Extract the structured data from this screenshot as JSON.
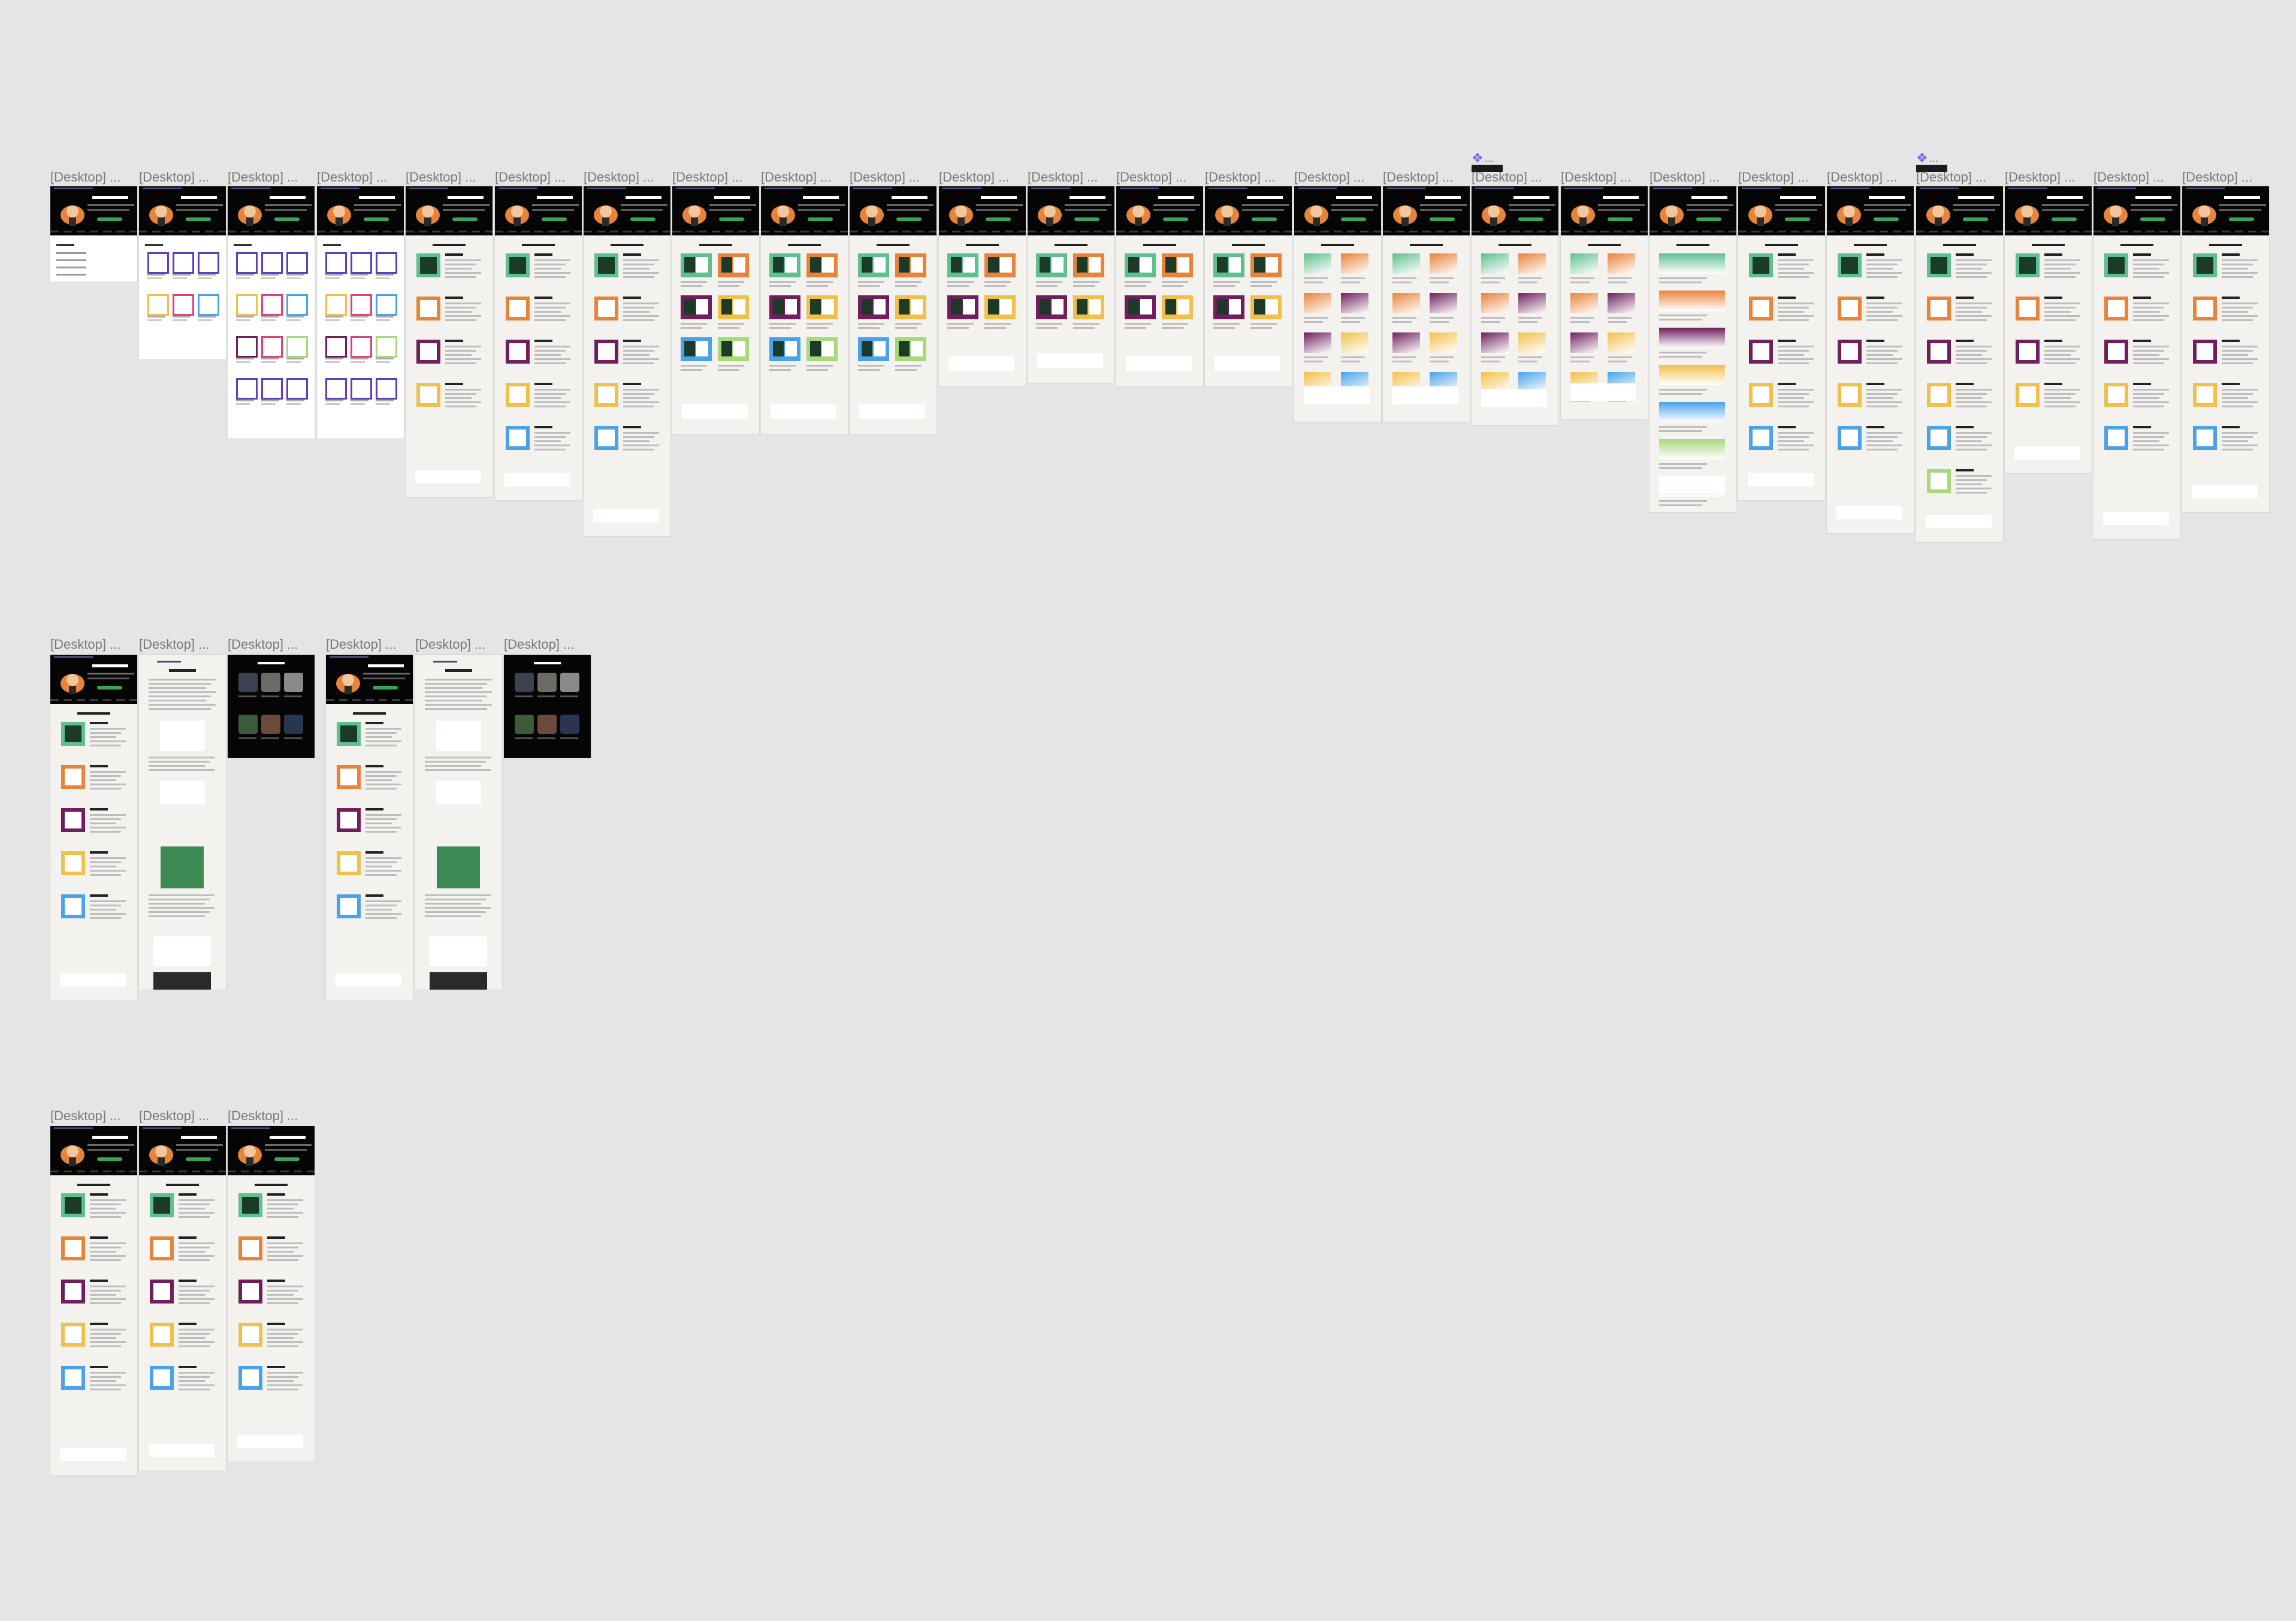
{
  "canvas": {
    "background": "#e5e5e5",
    "label_color": "#7a7a7a"
  },
  "frame_label": "[Desktop] ...",
  "component_icon": "component-icon",
  "component_glyph": "❖",
  "component_dots": "...",
  "accent_colors": {
    "green": "#5fbf8f",
    "orange": "#e8833a",
    "purple": "#6e1f5c",
    "yellow": "#f0c04a",
    "blue": "#4aa3e8",
    "lime": "#a7d87a",
    "indigo": "#5b3fbf",
    "pink": "#e0407a",
    "cta_green": "#3aa655"
  },
  "frames": [
    {
      "label": "[Desktop] ...",
      "kind": "list"
    },
    {
      "label": "[Desktop] ...",
      "kind": "grid"
    },
    {
      "label": "[Desktop] ...",
      "kind": "grid"
    },
    {
      "label": "[Desktop] ...",
      "kind": "grid"
    },
    {
      "label": "[Desktop] ...",
      "kind": "cards"
    },
    {
      "label": "[Desktop] ...",
      "kind": "cards"
    },
    {
      "label": "[Desktop] ...",
      "kind": "cards"
    },
    {
      "label": "[Desktop] ...",
      "kind": "pairs"
    },
    {
      "label": "[Desktop] ...",
      "kind": "pairs"
    },
    {
      "label": "[Desktop] ...",
      "kind": "pairs"
    },
    {
      "label": "[Desktop] ...",
      "kind": "pairs"
    },
    {
      "label": "[Desktop] ...",
      "kind": "pairs"
    },
    {
      "label": "[Desktop] ...",
      "kind": "pairs"
    },
    {
      "label": "[Desktop] ...",
      "kind": "pairs"
    },
    {
      "label": "[Desktop] ...",
      "kind": "gradients"
    },
    {
      "label": "[Desktop] ...",
      "kind": "gradients"
    },
    {
      "label": "[Desktop] ...",
      "kind": "gradients",
      "component": true
    },
    {
      "label": "[Desktop] ...",
      "kind": "gradients"
    },
    {
      "label": "[Desktop] ...",
      "kind": "wide-gradients"
    },
    {
      "label": "[Desktop] ...",
      "kind": "cards"
    },
    {
      "label": "[Desktop] ...",
      "kind": "cards"
    },
    {
      "label": "[Desktop] ...",
      "kind": "cards",
      "component": true
    },
    {
      "label": "[Desktop] ...",
      "kind": "cards"
    },
    {
      "label": "[Desktop] ...",
      "kind": "cards"
    },
    {
      "label": "[Desktop] ...",
      "kind": "cards"
    },
    {
      "label": "[Desktop] ...",
      "kind": "cards"
    },
    {
      "label": "[Desktop] ...",
      "kind": "article"
    },
    {
      "label": "[Desktop] ...",
      "kind": "photos"
    },
    {
      "label": "[Desktop] ...",
      "kind": "cards"
    },
    {
      "label": "[Desktop] ...",
      "kind": "article"
    },
    {
      "label": "[Desktop] ...",
      "kind": "photos"
    },
    {
      "label": "[Desktop] ...",
      "kind": "cards"
    },
    {
      "label": "[Desktop] ...",
      "kind": "cards"
    },
    {
      "label": "[Desktop] ...",
      "kind": "cards"
    }
  ]
}
